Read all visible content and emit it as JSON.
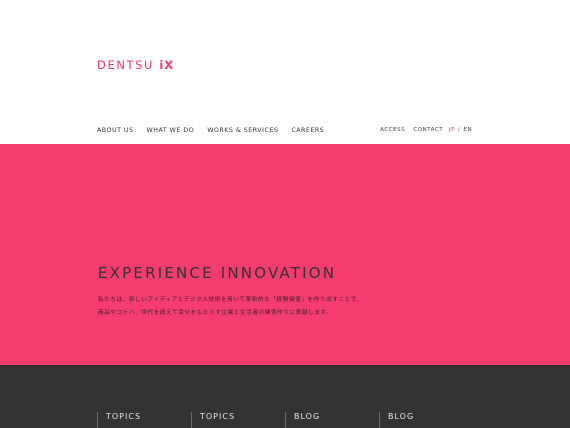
{
  "header": {
    "logo_text": "DENTSU",
    "logo_ix": "iX",
    "nav": [
      "ABOUT US",
      "WHAT WE DO",
      "WORKS & SERVICES",
      "CAREERS"
    ],
    "sub_nav": [
      "ACCESS",
      "CONTACT"
    ],
    "lang": {
      "jp": "JP",
      "separator": "/",
      "en": "EN"
    }
  },
  "hero": {
    "title": "EXPERIENCE INNOVATION",
    "lines": [
      "私たちは、新しいアイディアとデジタル技術を用いて革新的な「経験価値」を作り出すことで、",
      "商品やコトバ、世代を超えて幸せをもたらす企業と生活者の関係作りに貢献します。"
    ]
  },
  "footer": {
    "columns": [
      "TOPICS",
      "TOPICS",
      "BLOG",
      "BLOG"
    ]
  },
  "colors": {
    "accent": "#f53c6e",
    "logo": "#f2366a",
    "footer_bg": "#333333"
  }
}
